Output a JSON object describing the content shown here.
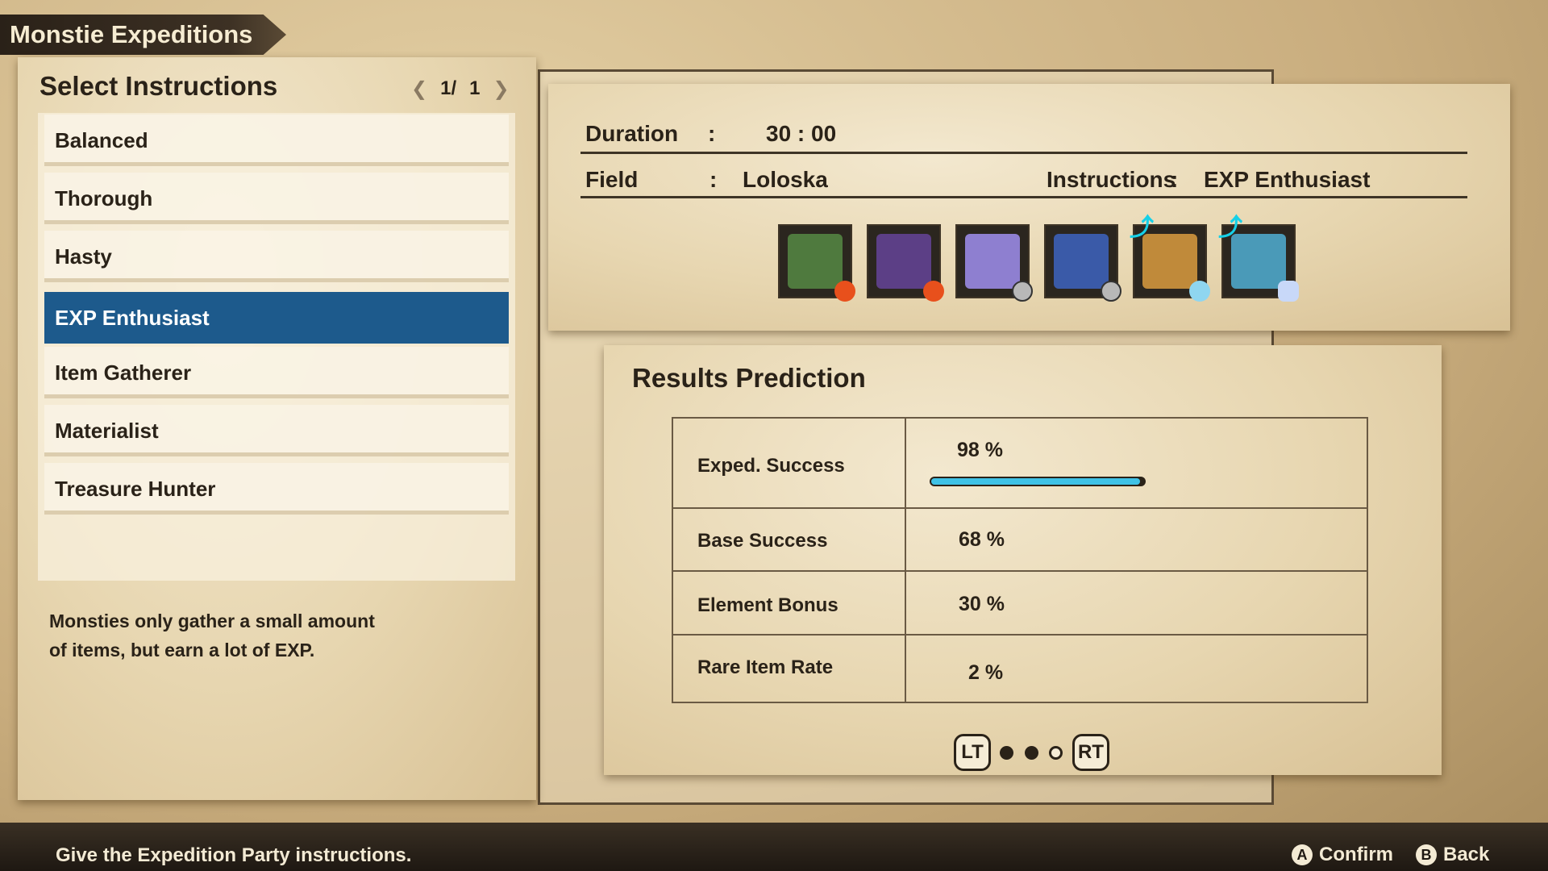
{
  "title": "Monstie Expeditions",
  "left_panel": {
    "title": "Select Instructions",
    "page_current": "1/",
    "page_total": "1",
    "items": [
      {
        "label": "Balanced"
      },
      {
        "label": "Thorough"
      },
      {
        "label": "Hasty"
      },
      {
        "label": "EXP Enthusiast",
        "selected": true
      },
      {
        "label": "Item Gatherer"
      },
      {
        "label": "Materialist"
      },
      {
        "label": "Treasure Hunter"
      }
    ],
    "description_line1": "Monsties only gather a small amount",
    "description_line2": "of items, but earn a lot of EXP."
  },
  "expedition": {
    "duration_label": "Duration",
    "duration_value": "30 : 00",
    "field_label": "Field",
    "field_value": "Loloska",
    "instructions_label": "Instructions",
    "instructions_value": "EXP Enthusiast",
    "colon": ":",
    "party": [
      {
        "icon": "green-monstie-icon",
        "element": "fire",
        "boost": false,
        "color": "#4f7a3e"
      },
      {
        "icon": "purple-monstie-icon",
        "element": "fire",
        "boost": false,
        "color": "#5c3f86"
      },
      {
        "icon": "lavender-monstie-icon",
        "element": "non-elemental",
        "boost": false,
        "color": "#8e7fd0"
      },
      {
        "icon": "blue-monstie-icon",
        "element": "non-elemental",
        "boost": false,
        "color": "#3a5aa8"
      },
      {
        "icon": "orange-monstie-icon",
        "element": "water",
        "boost": true,
        "color": "#c08a3a"
      },
      {
        "icon": "teal-monstie-icon",
        "element": "ice",
        "boost": true,
        "color": "#4a9ab8"
      }
    ]
  },
  "results": {
    "title": "Results Prediction",
    "rows": [
      {
        "label": "Exped. Success",
        "value": "98 %"
      },
      {
        "label": "Base Success",
        "value": "68 %"
      },
      {
        "label": "Element Bonus",
        "value": "30 %"
      },
      {
        "label": "Rare Item Rate",
        "value": "2 %"
      }
    ],
    "success_fraction": 0.98,
    "lt": "LT",
    "rt": "RT",
    "page_dots": 3,
    "active_dot": 2
  },
  "footer": {
    "hint": "Give the Expedition Party instructions.",
    "confirm_key": "A",
    "confirm": "Confirm",
    "back_key": "B",
    "back": "Back"
  }
}
